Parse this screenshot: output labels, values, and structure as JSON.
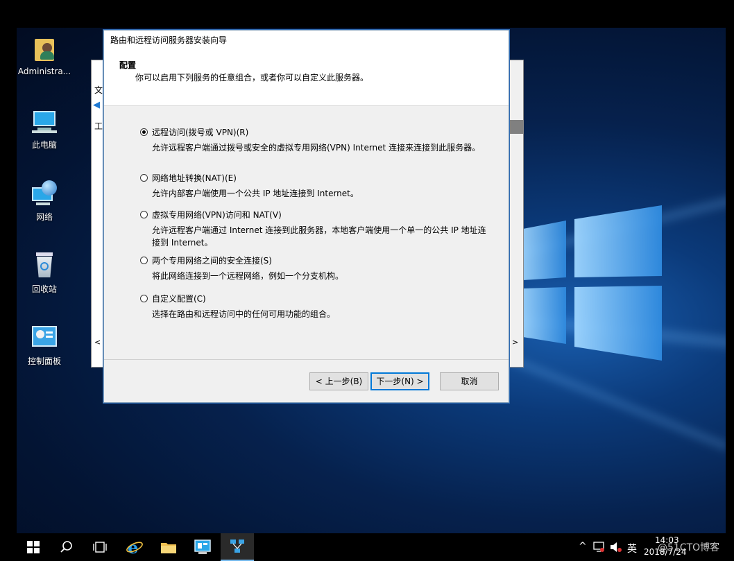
{
  "desktop": {
    "icons": [
      {
        "label": "Administra...",
        "icon": "user-folder-icon"
      },
      {
        "label": "此电脑",
        "icon": "computer-icon"
      },
      {
        "label": "网络",
        "icon": "network-icon"
      },
      {
        "label": "回收站",
        "icon": "recycle-bin-icon"
      },
      {
        "label": "控制面板",
        "icon": "control-panel-icon"
      }
    ]
  },
  "bg_window": {
    "fragments": [
      "文",
      "工"
    ]
  },
  "wizard": {
    "title": "路由和远程访问服务器安装向导",
    "header_title": "配置",
    "header_subtitle": "你可以启用下列服务的任意组合，或者你可以自定义此服务器。",
    "options": [
      {
        "label": "远程访问(拨号或 VPN)(R)",
        "description": "允许远程客户端通过拨号或安全的虚拟专用网络(VPN) Internet 连接来连接到此服务器。",
        "selected": true
      },
      {
        "label": "网络地址转换(NAT)(E)",
        "description": "允许内部客户端使用一个公共 IP 地址连接到 Internet。",
        "selected": false
      },
      {
        "label": "虚拟专用网络(VPN)访问和 NAT(V)",
        "description": "允许远程客户端通过 Internet 连接到此服务器，本地客户端使用一个单一的公共 IP 地址连接到 Internet。",
        "selected": false
      },
      {
        "label": "两个专用网络之间的安全连接(S)",
        "description": "将此网络连接到一个远程网络，例如一个分支机构。",
        "selected": false
      },
      {
        "label": "自定义配置(C)",
        "description": "选择在路由和远程访问中的任何可用功能的组合。",
        "selected": false
      }
    ],
    "buttons": {
      "back": "< 上一步(B)",
      "next": "下一步(N) >",
      "cancel": "取消"
    }
  },
  "taskbar": {
    "apps": [
      "start-icon",
      "search-icon",
      "task-view-icon",
      "internet-explorer-icon",
      "file-explorer-icon",
      "server-manager-icon",
      "routing-remote-access-icon"
    ]
  },
  "tray": {
    "ime": "英",
    "time": "14:03",
    "date": "2018/7/24",
    "watermark": "@51CTO博客"
  },
  "colors": {
    "accent": "#0078d7",
    "desktop_dark": "#031433",
    "taskbar": "#000000"
  }
}
